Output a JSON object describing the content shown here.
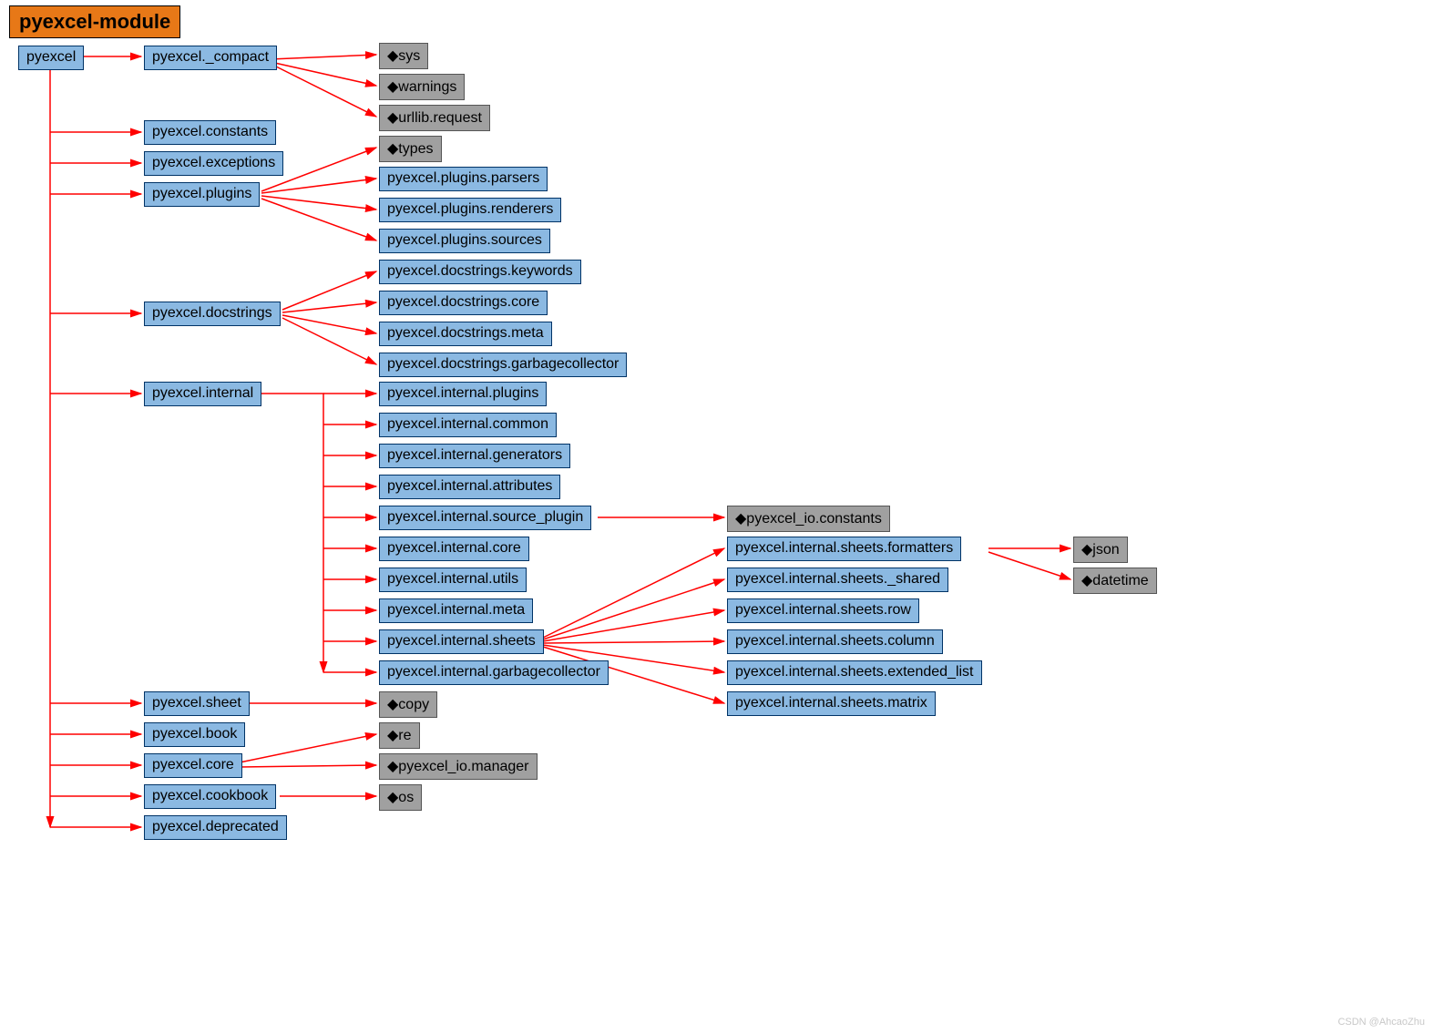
{
  "title": "pyexcel-module",
  "watermark": "CSDN @AhcaoZhu",
  "nodes": {
    "pyexcel": "pyexcel",
    "compact": "pyexcel._compact",
    "sys": "◆sys",
    "warnings": "◆warnings",
    "urllib_request": "◆urllib.request",
    "constants": "pyexcel.constants",
    "exceptions": "pyexcel.exceptions",
    "plugins": "pyexcel.plugins",
    "types": "◆types",
    "plugins_parsers": "pyexcel.plugins.parsers",
    "plugins_renderers": "pyexcel.plugins.renderers",
    "plugins_sources": "pyexcel.plugins.sources",
    "docstrings": "pyexcel.docstrings",
    "doc_keywords": "pyexcel.docstrings.keywords",
    "doc_core": "pyexcel.docstrings.core",
    "doc_meta": "pyexcel.docstrings.meta",
    "doc_gc": "pyexcel.docstrings.garbagecollector",
    "internal": "pyexcel.internal",
    "int_plugins": "pyexcel.internal.plugins",
    "int_common": "pyexcel.internal.common",
    "int_generators": "pyexcel.internal.generators",
    "int_attributes": "pyexcel.internal.attributes",
    "int_source_plugin": "pyexcel.internal.source_plugin",
    "int_core": "pyexcel.internal.core",
    "int_utils": "pyexcel.internal.utils",
    "int_meta": "pyexcel.internal.meta",
    "int_sheets": "pyexcel.internal.sheets",
    "int_gc": "pyexcel.internal.garbagecollector",
    "io_constants": "◆pyexcel_io.constants",
    "sheets_formatters": "pyexcel.internal.sheets.formatters",
    "sheets_shared": "pyexcel.internal.sheets._shared",
    "sheets_row": "pyexcel.internal.sheets.row",
    "sheets_column": "pyexcel.internal.sheets.column",
    "sheets_extlist": "pyexcel.internal.sheets.extended_list",
    "sheets_matrix": "pyexcel.internal.sheets.matrix",
    "json": "◆json",
    "datetime": "◆datetime",
    "sheet": "pyexcel.sheet",
    "book": "pyexcel.book",
    "core": "pyexcel.core",
    "cookbook": "pyexcel.cookbook",
    "deprecated": "pyexcel.deprecated",
    "copy": "◆copy",
    "re": "◆re",
    "io_manager": "◆pyexcel_io.manager",
    "os": "◆os"
  },
  "chart_data": {
    "type": "tree",
    "title": "pyexcel-module",
    "edges": [
      [
        "pyexcel",
        "pyexcel._compact"
      ],
      [
        "pyexcel._compact",
        "sys"
      ],
      [
        "pyexcel._compact",
        "warnings"
      ],
      [
        "pyexcel._compact",
        "urllib.request"
      ],
      [
        "pyexcel",
        "pyexcel.constants"
      ],
      [
        "pyexcel",
        "pyexcel.exceptions"
      ],
      [
        "pyexcel",
        "pyexcel.plugins"
      ],
      [
        "pyexcel.plugins",
        "types"
      ],
      [
        "pyexcel.plugins",
        "pyexcel.plugins.parsers"
      ],
      [
        "pyexcel.plugins",
        "pyexcel.plugins.renderers"
      ],
      [
        "pyexcel.plugins",
        "pyexcel.plugins.sources"
      ],
      [
        "pyexcel",
        "pyexcel.docstrings"
      ],
      [
        "pyexcel.docstrings",
        "pyexcel.docstrings.keywords"
      ],
      [
        "pyexcel.docstrings",
        "pyexcel.docstrings.core"
      ],
      [
        "pyexcel.docstrings",
        "pyexcel.docstrings.meta"
      ],
      [
        "pyexcel.docstrings",
        "pyexcel.docstrings.garbagecollector"
      ],
      [
        "pyexcel",
        "pyexcel.internal"
      ],
      [
        "pyexcel.internal",
        "pyexcel.internal.plugins"
      ],
      [
        "pyexcel.internal",
        "pyexcel.internal.common"
      ],
      [
        "pyexcel.internal",
        "pyexcel.internal.generators"
      ],
      [
        "pyexcel.internal",
        "pyexcel.internal.attributes"
      ],
      [
        "pyexcel.internal",
        "pyexcel.internal.source_plugin"
      ],
      [
        "pyexcel.internal",
        "pyexcel.internal.core"
      ],
      [
        "pyexcel.internal",
        "pyexcel.internal.utils"
      ],
      [
        "pyexcel.internal",
        "pyexcel.internal.meta"
      ],
      [
        "pyexcel.internal",
        "pyexcel.internal.sheets"
      ],
      [
        "pyexcel.internal",
        "pyexcel.internal.garbagecollector"
      ],
      [
        "pyexcel.internal.source_plugin",
        "pyexcel_io.constants"
      ],
      [
        "pyexcel.internal.sheets",
        "pyexcel.internal.sheets.formatters"
      ],
      [
        "pyexcel.internal.sheets",
        "pyexcel.internal.sheets._shared"
      ],
      [
        "pyexcel.internal.sheets",
        "pyexcel.internal.sheets.row"
      ],
      [
        "pyexcel.internal.sheets",
        "pyexcel.internal.sheets.column"
      ],
      [
        "pyexcel.internal.sheets",
        "pyexcel.internal.sheets.extended_list"
      ],
      [
        "pyexcel.internal.sheets",
        "pyexcel.internal.sheets.matrix"
      ],
      [
        "pyexcel.internal.sheets.formatters",
        "json"
      ],
      [
        "pyexcel.internal.sheets.formatters",
        "datetime"
      ],
      [
        "pyexcel",
        "pyexcel.sheet"
      ],
      [
        "pyexcel",
        "pyexcel.book"
      ],
      [
        "pyexcel",
        "pyexcel.core"
      ],
      [
        "pyexcel",
        "pyexcel.cookbook"
      ],
      [
        "pyexcel",
        "pyexcel.deprecated"
      ],
      [
        "pyexcel.sheet",
        "copy"
      ],
      [
        "pyexcel.core",
        "re"
      ],
      [
        "pyexcel.core",
        "pyexcel_io.manager"
      ],
      [
        "pyexcel.cookbook",
        "os"
      ]
    ]
  }
}
